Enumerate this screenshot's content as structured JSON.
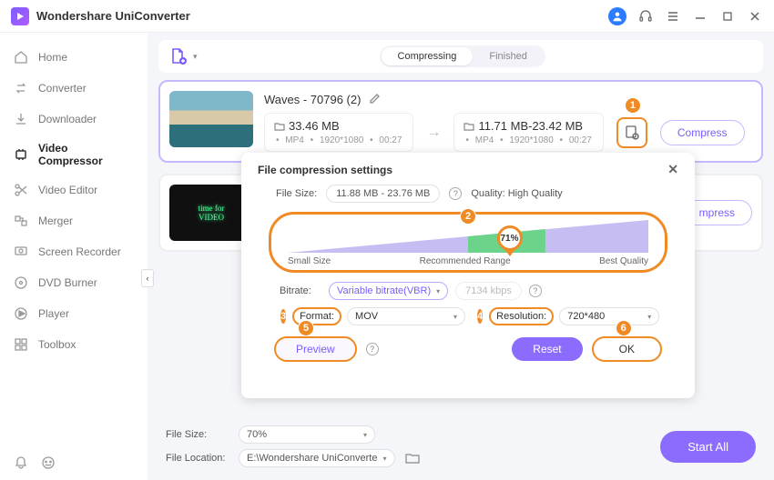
{
  "app_title": "Wondershare UniConverter",
  "titlebar_icons": {
    "user": "👤",
    "headset": "🎧"
  },
  "sidebar": {
    "items": [
      {
        "label": "Home"
      },
      {
        "label": "Converter"
      },
      {
        "label": "Downloader"
      },
      {
        "label": "Video Compressor"
      },
      {
        "label": "Video Editor"
      },
      {
        "label": "Merger"
      },
      {
        "label": "Screen Recorder"
      },
      {
        "label": "DVD Burner"
      },
      {
        "label": "Player"
      },
      {
        "label": "Toolbox"
      }
    ],
    "active_index": 3
  },
  "tabs": {
    "compressing": "Compressing",
    "finished": "Finished"
  },
  "file1": {
    "name": "Waves - 70796 (2)",
    "src": {
      "size": "33.46 MB",
      "fmt": "MP4",
      "res": "1920*1080",
      "dur": "00:27"
    },
    "dst": {
      "size": "11.71 MB-23.42 MB",
      "fmt": "MP4",
      "res": "1920*1080",
      "dur": "00:27"
    },
    "compress_label": "Compress"
  },
  "file2": {
    "compress_label": "mpress"
  },
  "dialog": {
    "title": "File compression settings",
    "filesize_label": "File Size:",
    "filesize_value": "11.88 MB - 23.76 MB",
    "quality_label": "Quality: High Quality",
    "slider": {
      "value_label": "71%",
      "left": "Small Size",
      "mid": "Recommended Range",
      "right": "Best Quality"
    },
    "bitrate_label": "Bitrate:",
    "bitrate_value": "Variable bitrate(VBR)",
    "bitrate_input": "7134 kbps",
    "format_label": "Format:",
    "format_value": "MOV",
    "resolution_label": "Resolution:",
    "resolution_value": "720*480",
    "preview": "Preview",
    "reset": "Reset",
    "ok": "OK"
  },
  "bottom": {
    "filesize_label": "File Size:",
    "filesize_value": "70%",
    "location_label": "File Location:",
    "location_value": "E:\\Wondershare UniConverte",
    "startall": "Start All"
  },
  "annotations": {
    "a1": "1",
    "a2": "2",
    "a3": "3",
    "a4": "4",
    "a5": "5",
    "a6": "6"
  },
  "glyphs": {
    "folder": "🗀",
    "caret": "▾",
    "dot": "•",
    "edit": "✎",
    "close": "✕"
  }
}
